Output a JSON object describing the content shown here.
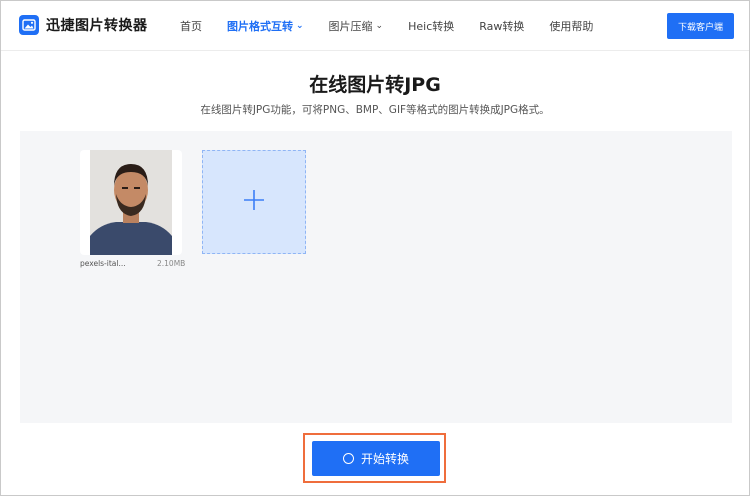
{
  "header": {
    "logo_text": "迅捷图片转换器",
    "nav": [
      {
        "label": "首页",
        "active": false,
        "has_dropdown": false
      },
      {
        "label": "图片格式互转",
        "active": true,
        "has_dropdown": true
      },
      {
        "label": "图片压缩",
        "active": false,
        "has_dropdown": true
      },
      {
        "label": "Heic转换",
        "active": false,
        "has_dropdown": false
      },
      {
        "label": "Raw转换",
        "active": false,
        "has_dropdown": false
      },
      {
        "label": "使用帮助",
        "active": false,
        "has_dropdown": false
      }
    ],
    "download_label": "下载客户端"
  },
  "main": {
    "title": "在线图片转JPG",
    "subtitle": "在线图片转JPG功能，可将PNG、BMP、GIF等格式的图片转换成JPG格式。",
    "files": [
      {
        "name": "pexels-ital...",
        "size": "2.10MB"
      }
    ],
    "start_label": "开始转换"
  },
  "colors": {
    "brand": "#1f6ff5",
    "highlight": "#ef6d3c",
    "upload_bg": "#f5f6f8",
    "add_box_bg": "#d7e6fd"
  },
  "icons": {
    "logo": "image-icon",
    "add": "plus-icon",
    "start": "ring-icon",
    "dropdown": "chevron-down-icon"
  }
}
